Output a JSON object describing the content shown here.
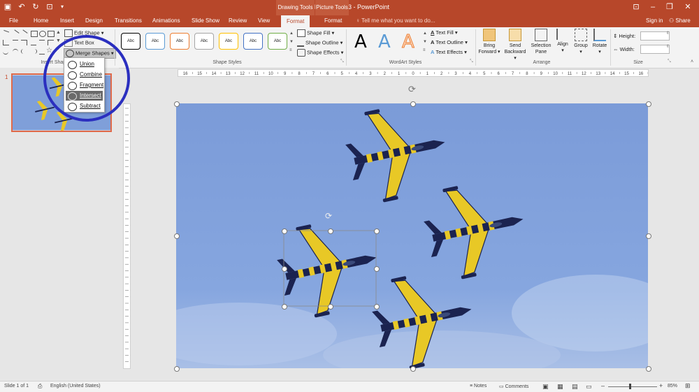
{
  "window": {
    "title": "Plane-Shape-3 - PowerPoint",
    "context_groups": [
      "Drawing Tools",
      "Picture Tools"
    ]
  },
  "tabs": {
    "file": "File",
    "home": "Home",
    "insert": "Insert",
    "design": "Design",
    "transitions": "Transitions",
    "animations": "Animations",
    "slideshow": "Slide Show",
    "review": "Review",
    "view": "View",
    "format_drawing": "Format",
    "format_picture": "Format",
    "tell_me": "Tell me what you want to do...",
    "sign_in": "Sign in",
    "share": "Share"
  },
  "ribbon": {
    "insert_shapes": {
      "label": "Insert Shapes",
      "edit_shape": "Edit Shape",
      "text_box": "Text Box",
      "merge_shapes": "Merge Shapes"
    },
    "shape_styles": {
      "label": "Shape Styles",
      "swatch_text": "Abc",
      "swatch_colors": [
        "#000000",
        "#5b9bd5",
        "#ed7d31",
        "#a5a5a5",
        "#ffc000",
        "#4472c4",
        "#70ad47"
      ],
      "shape_fill": "Shape Fill",
      "shape_outline": "Shape Outline",
      "shape_effects": "Shape Effects"
    },
    "wordart_styles": {
      "label": "WordArt Styles",
      "letters": [
        "A",
        "A",
        "A"
      ],
      "letter_colors": [
        "#000000",
        "#5b9bd5",
        "#f4b183"
      ],
      "text_fill": "Text Fill",
      "text_outline": "Text Outline",
      "text_effects": "Text Effects"
    },
    "arrange": {
      "label": "Arrange",
      "bring_forward_1": "Bring",
      "bring_forward_2": "Forward",
      "send_backward_1": "Send",
      "send_backward_2": "Backward",
      "selection_pane_1": "Selection",
      "selection_pane_2": "Pane",
      "align": "Align",
      "group": "Group",
      "rotate": "Rotate"
    },
    "size": {
      "label": "Size",
      "height": "Height:",
      "width": "Width:"
    }
  },
  "merge_menu": {
    "items": [
      "Union",
      "Combine",
      "Fragment",
      "Intersect",
      "Subtract"
    ],
    "highlighted": "Intersect"
  },
  "slides_pane": {
    "slide_number": "1"
  },
  "ruler": {
    "ticks": [
      "16",
      "15",
      "14",
      "13",
      "12",
      "11",
      "10",
      "9",
      "8",
      "7",
      "6",
      "5",
      "4",
      "3",
      "2",
      "1",
      "0",
      "1",
      "2",
      "3",
      "4",
      "5",
      "6",
      "7",
      "8",
      "9",
      "10",
      "11",
      "12",
      "13",
      "14",
      "15",
      "16"
    ]
  },
  "status": {
    "slide_info": "Slide 1 of 1",
    "language": "English (United States)",
    "notes": "Notes",
    "comments": "Comments",
    "zoom": "85%"
  },
  "colors": {
    "accent": "#b7472a",
    "sky": "#7f9fd9",
    "plane_body": "#1b2350",
    "plane_stripe": "#e8c826",
    "annotation_circle": "#2b2fbf"
  }
}
